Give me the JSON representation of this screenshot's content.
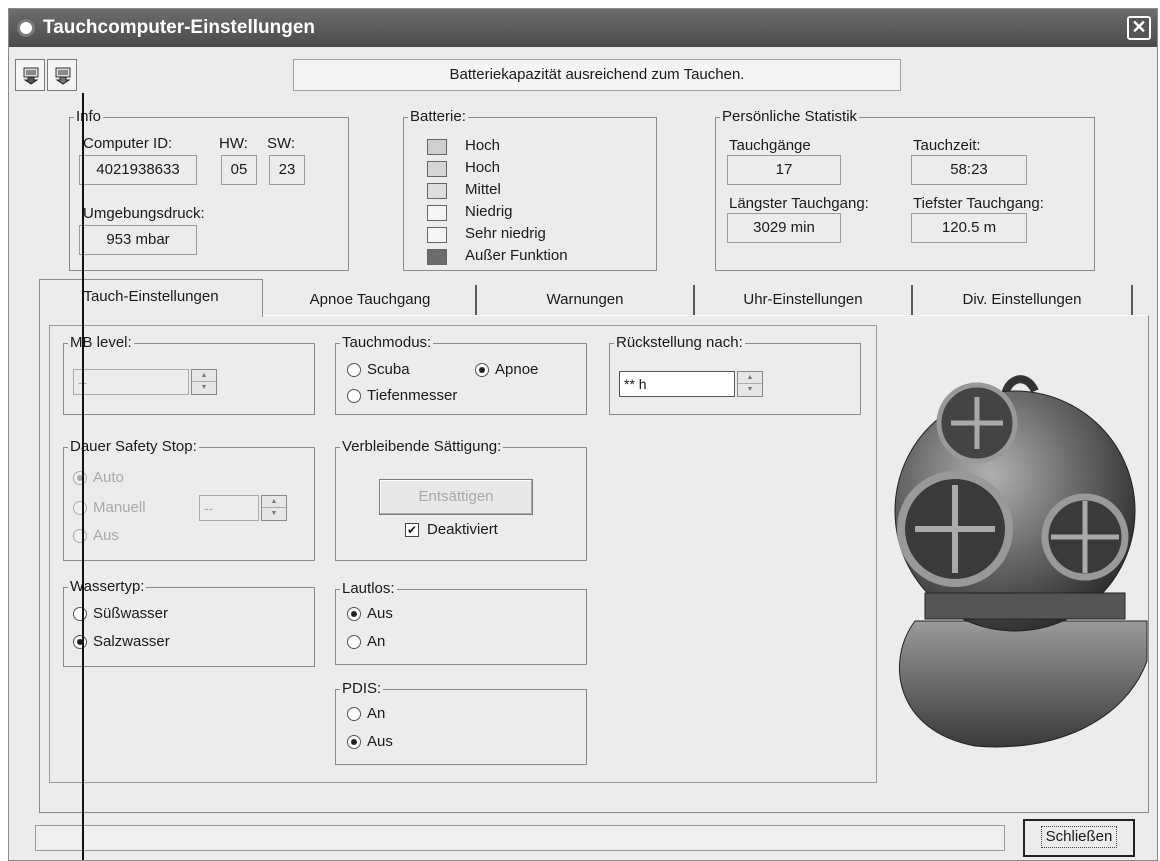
{
  "window": {
    "title": "Tauchcomputer-Einstellungen",
    "close_glyph": "✕"
  },
  "toolbar": {
    "button1_icon": "download-to-computer-icon",
    "button2_icon": "upload-to-device-icon"
  },
  "status_message": "Batteriekapazität ausreichend zum Tauchen.",
  "info": {
    "title": "Info",
    "computer_id_label": "Computer ID:",
    "computer_id": "4021938633",
    "hw_label": "HW:",
    "hw": "05",
    "sw_label": "SW:",
    "sw": "23",
    "pressure_label": "Umgebungsdruck:",
    "pressure": "953 mbar"
  },
  "battery": {
    "title": "Batterie:",
    "levels": [
      {
        "label": "Hoch",
        "color": "#cfcfcf"
      },
      {
        "label": "Hoch",
        "color": "#d6d6d6"
      },
      {
        "label": "Mittel",
        "color": "#dedede"
      },
      {
        "label": "Niedrig",
        "color": "#f6f6f6"
      },
      {
        "label": "Sehr niedrig",
        "color": "#f6f6f6"
      },
      {
        "label": "Außer Funktion",
        "color": "#6c6c6c"
      }
    ]
  },
  "stats": {
    "title": "Persönliche Statistik",
    "dives_label": "Tauchgänge",
    "dives": "17",
    "divetime_label": "Tauchzeit:",
    "divetime": "58:23",
    "longest_label": "Längster Tauchgang:",
    "longest": "3029 min",
    "deepest_label": "Tiefster Tauchgang:",
    "deepest": "120.5 m"
  },
  "tabs": [
    "Tauch-Einstellungen",
    "Apnoe Tauchgang",
    "Warnungen",
    "Uhr-Einstellungen",
    "Div. Einstellungen"
  ],
  "active_tab": "Tauch-Einstellungen",
  "mb_level": {
    "title": "MB level:",
    "value": "--"
  },
  "safety_stop": {
    "title": "Dauer Safety Stop:",
    "options": [
      "Auto",
      "Manuell",
      "Aus"
    ],
    "selected": "Auto",
    "manual_value": "--"
  },
  "water": {
    "title": "Wassertyp:",
    "options": [
      "Süßwasser",
      "Salzwasser"
    ],
    "selected": "Salzwasser"
  },
  "dive_mode": {
    "title": "Tauchmodus:",
    "options": [
      "Scuba",
      "Apnoe",
      "Tiefenmesser"
    ],
    "selected": "Apnoe"
  },
  "desaturation": {
    "title": "Verbleibende Sättigung:",
    "button": "Entsättigen",
    "checkbox": "Deaktiviert",
    "checked": true
  },
  "silent": {
    "title": "Lautlos:",
    "options": [
      "Aus",
      "An"
    ],
    "selected": "Aus"
  },
  "pdis": {
    "title": "PDIS:",
    "options": [
      "An",
      "Aus"
    ],
    "selected": "Aus"
  },
  "reset": {
    "title": "Rückstellung nach:",
    "value": "** h"
  },
  "image": {
    "subject": "diving-helmet-image"
  },
  "close_button": "Schließen"
}
